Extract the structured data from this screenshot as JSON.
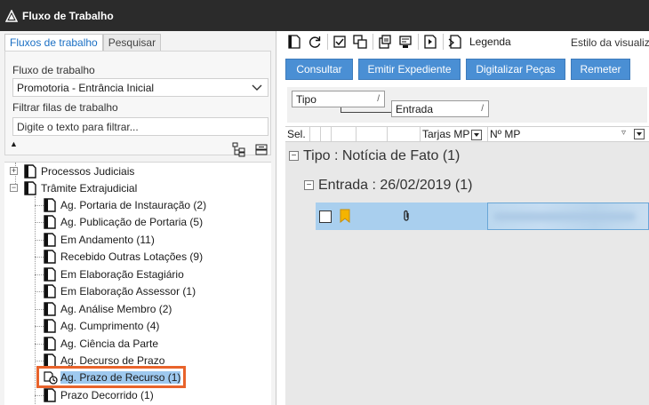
{
  "window": {
    "title": "Fluxo de Trabalho"
  },
  "left": {
    "tabs": [
      {
        "label": "Fluxos de trabalho",
        "active": true
      },
      {
        "label": "Pesquisar",
        "active": false
      }
    ],
    "workflow_label": "Fluxo de trabalho",
    "workflow_value": "Promotoria - Entrância Inicial",
    "filter_label": "Filtrar filas de trabalho",
    "filter_value": "Digite o texto para filtrar...",
    "tree": [
      {
        "label": "Processos Judiciais",
        "expander": "+"
      },
      {
        "label": "Trâmite Extrajudicial",
        "expander": "−"
      },
      {
        "label": "Ag. Portaria de Instauração (2)"
      },
      {
        "label": "Ag. Publicação de Portaria (5)"
      },
      {
        "label": "Em Andamento (11)"
      },
      {
        "label": "Recebido Outras Lotações (9)"
      },
      {
        "label": "Em Elaboração Estagiário"
      },
      {
        "label": "Em Elaboração Assessor (1)"
      },
      {
        "label": "Ag. Análise Membro (2)"
      },
      {
        "label": "Ag. Cumprimento (4)"
      },
      {
        "label": "Ag. Ciência da Parte"
      },
      {
        "label": "Ag. Decurso de Prazo"
      },
      {
        "label": "Ag. Prazo de Recurso (1)",
        "selected": true
      },
      {
        "label": "Prazo Decorrido (1)"
      }
    ]
  },
  "right": {
    "toolbar": {
      "legend_label": "Legenda",
      "style_label": "Estilo da visualiz"
    },
    "actions": [
      "Consultar",
      "Emitir Expediente",
      "Digitalizar Peças",
      "Remeter"
    ],
    "group_chips": [
      "Tipo",
      "Entrada"
    ],
    "columns": {
      "sel": "Sel.",
      "tarjas": "Tarjas MP",
      "numero": "Nº MP"
    },
    "groups": {
      "level1": {
        "text": "Tipo : Notícia de Fato  (1)",
        "expander": "−"
      },
      "level2": {
        "text": "Entrada : 26/02/2019  (1)",
        "expander": "−"
      }
    }
  },
  "colors": {
    "titlebar": "#2b2b2b",
    "button": "#4a8fd4",
    "selected_row": "#a9cfee",
    "highlight_border": "#e8632b",
    "tab_active_text": "#1a6fc4"
  }
}
